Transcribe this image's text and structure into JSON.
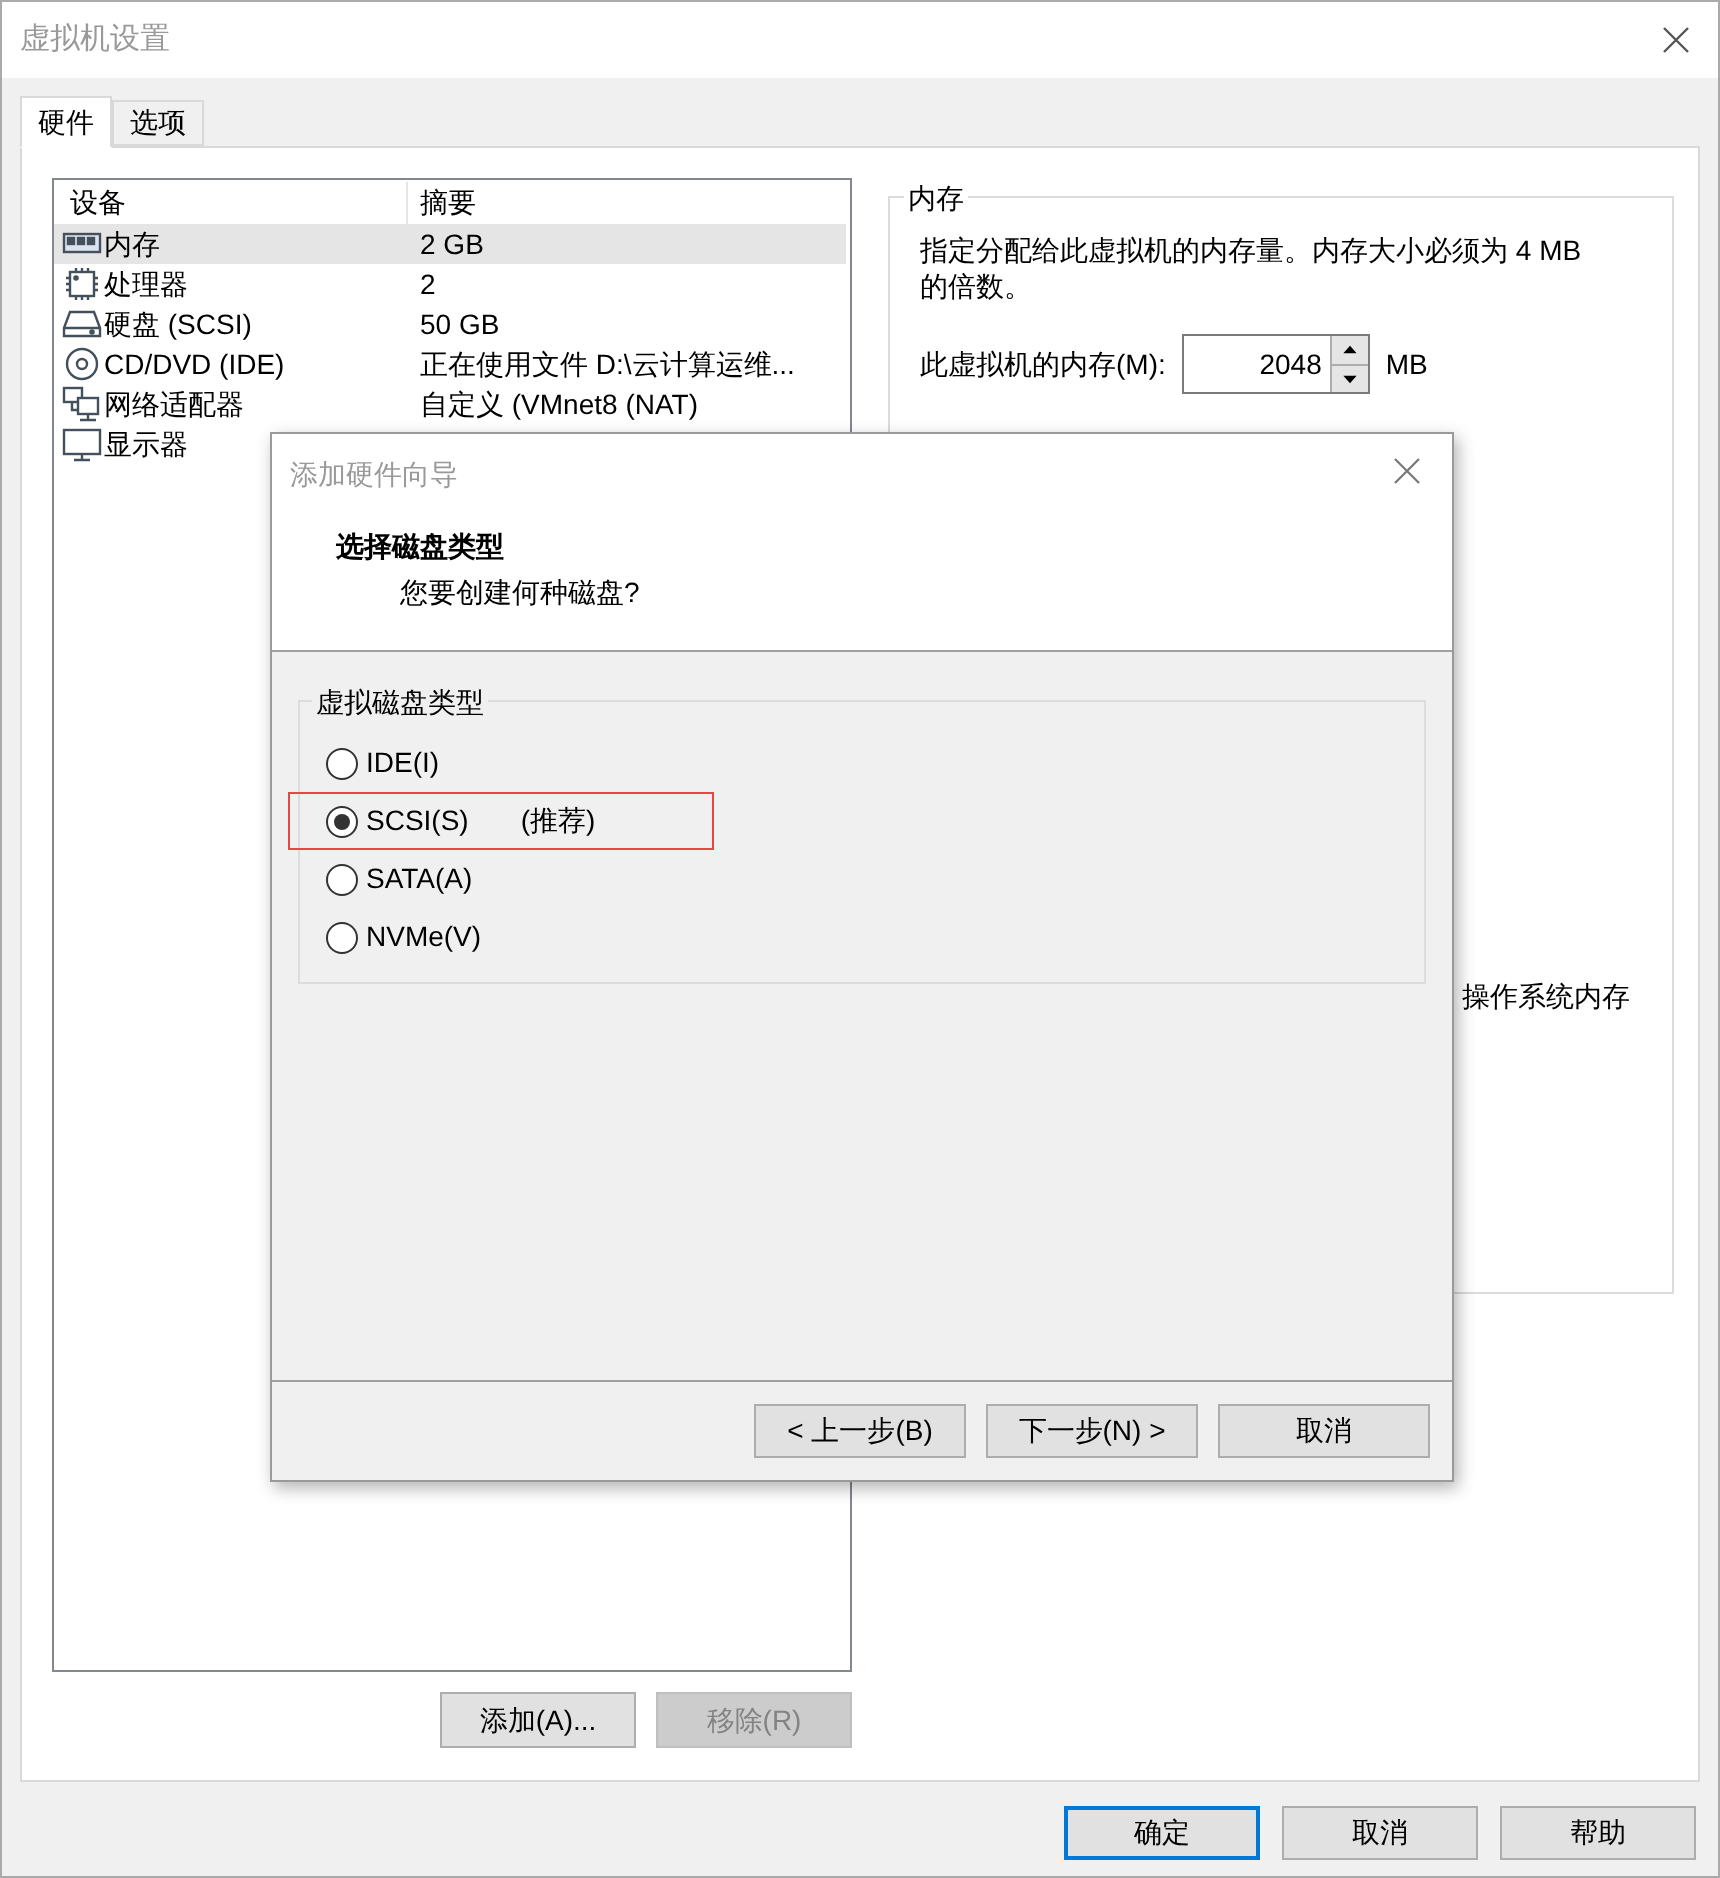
{
  "window": {
    "title": "虚拟机设置"
  },
  "tabs": [
    {
      "label": "硬件",
      "selected": true
    },
    {
      "label": "选项",
      "selected": false
    }
  ],
  "devices": {
    "columns": [
      "设备",
      "摘要"
    ],
    "rows": [
      {
        "kind": "memory",
        "name": "内存",
        "summary": "2 GB",
        "selected": true
      },
      {
        "kind": "cpu",
        "name": "处理器",
        "summary": "2",
        "selected": false
      },
      {
        "kind": "disk",
        "name": "硬盘 (SCSI)",
        "summary": "50 GB",
        "selected": false
      },
      {
        "kind": "cd",
        "name": "CD/DVD (IDE)",
        "summary": "正在使用文件 D:\\云计算运维...",
        "selected": false
      },
      {
        "kind": "network",
        "name": "网络适配器",
        "summary": "自定义 (VMnet8 (NAT)",
        "selected": false
      },
      {
        "kind": "display",
        "name": "显示器",
        "selected": false
      }
    ]
  },
  "device_buttons": [
    {
      "label": "添加(A)...",
      "disabled": false
    },
    {
      "label": "移除(R)",
      "disabled": true
    }
  ],
  "memory_panel": {
    "title": "内存",
    "description": "指定分配给此虚拟机的内存量。内存大小必须为 4 MB 的倍数。",
    "field_label": "此虚拟机的内存(M):",
    "value": "2048",
    "unit": "MB",
    "partial_text": "操作系统内存"
  },
  "buttons": [
    {
      "label": "确定",
      "default": true
    },
    {
      "label": "取消",
      "default": false
    },
    {
      "label": "帮助",
      "default": false
    }
  ],
  "dialog": {
    "title": "添加硬件向导",
    "heading": "选择磁盘类型",
    "subheading": "您要创建何种磁盘?",
    "group_label": "虚拟磁盘类型",
    "options": [
      {
        "label": "IDE(I)",
        "selected": false,
        "highlighted": false
      },
      {
        "label": "SCSI(S)",
        "note": "(推荐)",
        "selected": true,
        "highlighted": true
      },
      {
        "label": "SATA(A)",
        "selected": false,
        "highlighted": false
      },
      {
        "label": "NVMe(V)",
        "selected": false,
        "highlighted": false
      }
    ],
    "buttons": [
      "< 上一步(B)",
      "下一步(N) >",
      "取消"
    ]
  }
}
